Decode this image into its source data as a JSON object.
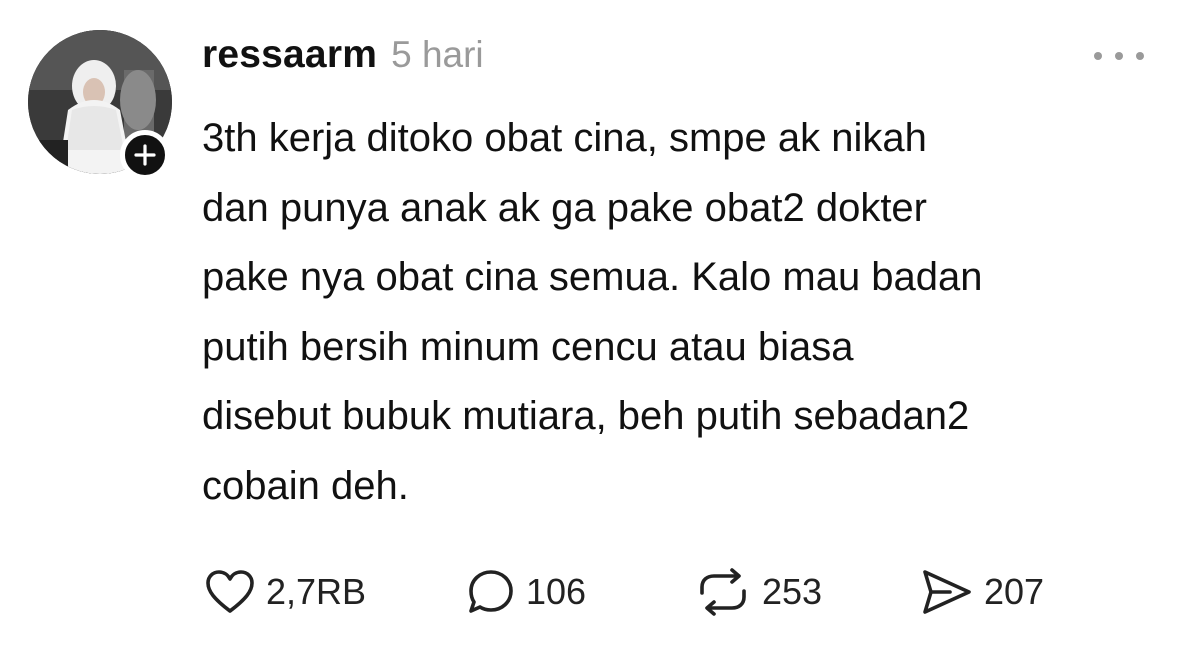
{
  "post": {
    "username": "ressaarm",
    "timestamp": "5 hari",
    "body": "3th kerja ditoko obat cina, smpe ak nikah\ndan punya anak ak ga pake obat2 dokter\npake nya obat cina semua. Kalo mau badan\nputih bersih minum cencu atau biasa\ndisebut bubuk mutiara, beh putih sebadan2\ncobain deh.",
    "avatar_icon": "avatar-photo",
    "follow_icon": "plus-icon",
    "more_icon": "more-dots-icon"
  },
  "actions": {
    "like": {
      "icon": "heart-icon",
      "count": "2,7RB"
    },
    "reply": {
      "icon": "comment-bubble-icon",
      "count": "106"
    },
    "repost": {
      "icon": "repost-icon",
      "count": "253"
    },
    "share": {
      "icon": "send-icon",
      "count": "207"
    }
  },
  "colors": {
    "text": "#111111",
    "muted": "#9a9a9a",
    "background": "#ffffff"
  }
}
